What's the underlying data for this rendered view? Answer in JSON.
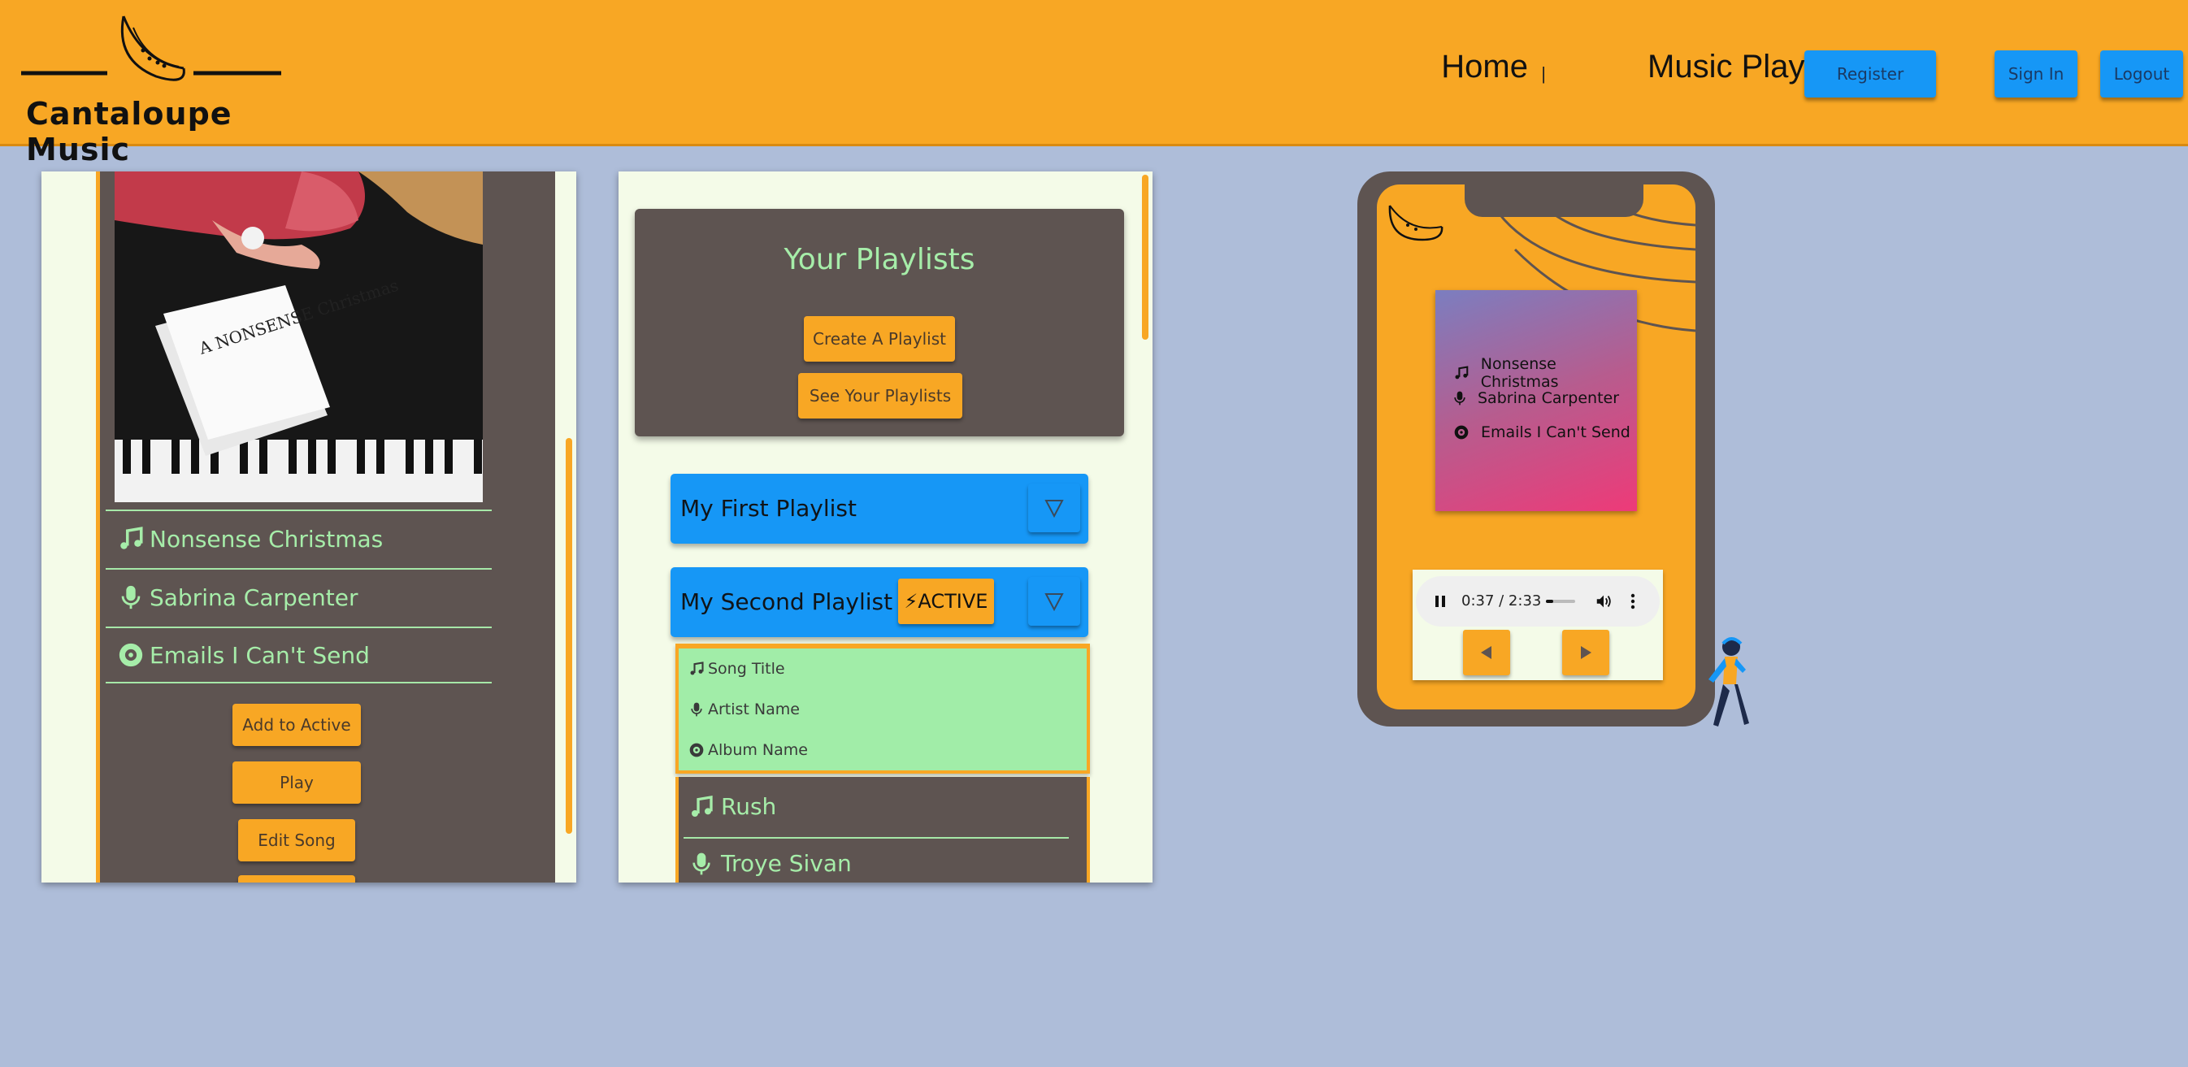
{
  "brand": {
    "name": "Cantaloupe Music",
    "logo_icon": "melon-slice-icon"
  },
  "nav": {
    "home": "Home",
    "separator": "|",
    "music_player": "Music Player",
    "register": "Register",
    "sign_in": "Sign In",
    "logout": "Logout"
  },
  "song_panel": {
    "album_art_text": "A NONSENSE Christmas",
    "title": "Nonsense Christmas",
    "artist": "Sabrina Carpenter",
    "album": "Emails I Can't Send",
    "buttons": {
      "add_to_active": "Add to Active",
      "play": "Play",
      "edit_song": "Edit Song"
    }
  },
  "playlists_panel": {
    "heading": "Your Playlists",
    "create_button": "Create A Playlist",
    "see_button": "See Your Playlists",
    "playlists": [
      {
        "name": "My First Playlist"
      },
      {
        "name": "My Second Playlist",
        "badge": "⚡ACTIVE"
      }
    ],
    "column_headers": {
      "song": "Song Title",
      "artist": "Artist Name",
      "album": "Album Name"
    },
    "songs": [
      {
        "title": "Rush",
        "artist": "Troye Sivan"
      }
    ]
  },
  "phone_player": {
    "now_playing": {
      "title": "Nonsense Christmas",
      "artist": "Sabrina Carpenter",
      "album": "Emails I Can't Send"
    },
    "time": "0:37 / 2:33",
    "progress": 0.24
  },
  "colors": {
    "orange": "#f8a724",
    "blue": "#1697f6",
    "green": "#a6eda9",
    "dark": "#5e5451",
    "background": "#aebdd9"
  }
}
